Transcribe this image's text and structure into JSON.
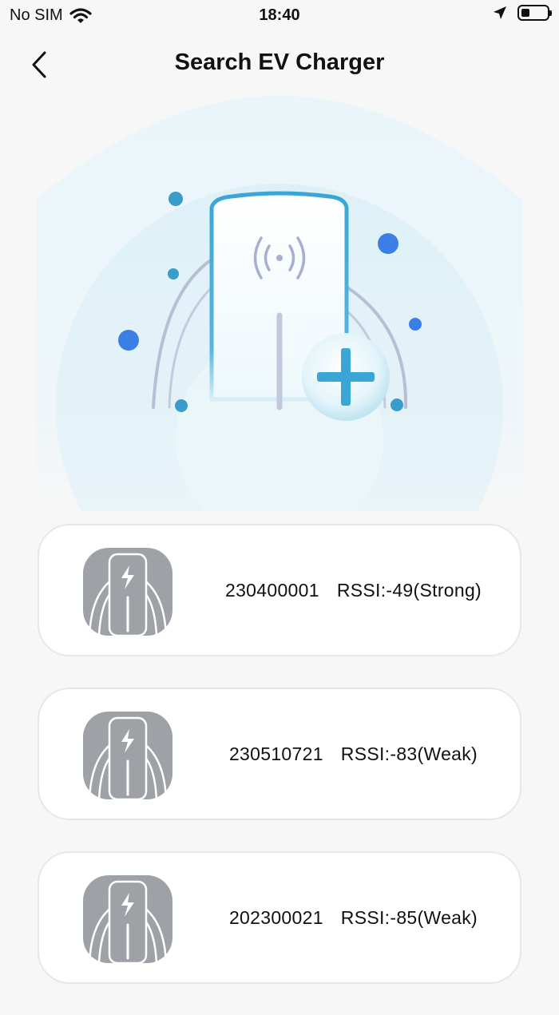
{
  "status_bar": {
    "carrier": "No SIM",
    "time": "18:40"
  },
  "header": {
    "title": "Search EV Charger"
  },
  "devices": [
    {
      "id": "230400001",
      "rssi": "RSSI:-49(Strong)"
    },
    {
      "id": "230510721",
      "rssi": "RSSI:-83(Weak)"
    },
    {
      "id": "202300021",
      "rssi": "RSSI:-85(Weak)"
    }
  ],
  "colors": {
    "accent": "#3aa6d6",
    "dot": "#3b7fe6",
    "icon_gray": "#9ea2a7",
    "background": "#f7f7f7"
  }
}
